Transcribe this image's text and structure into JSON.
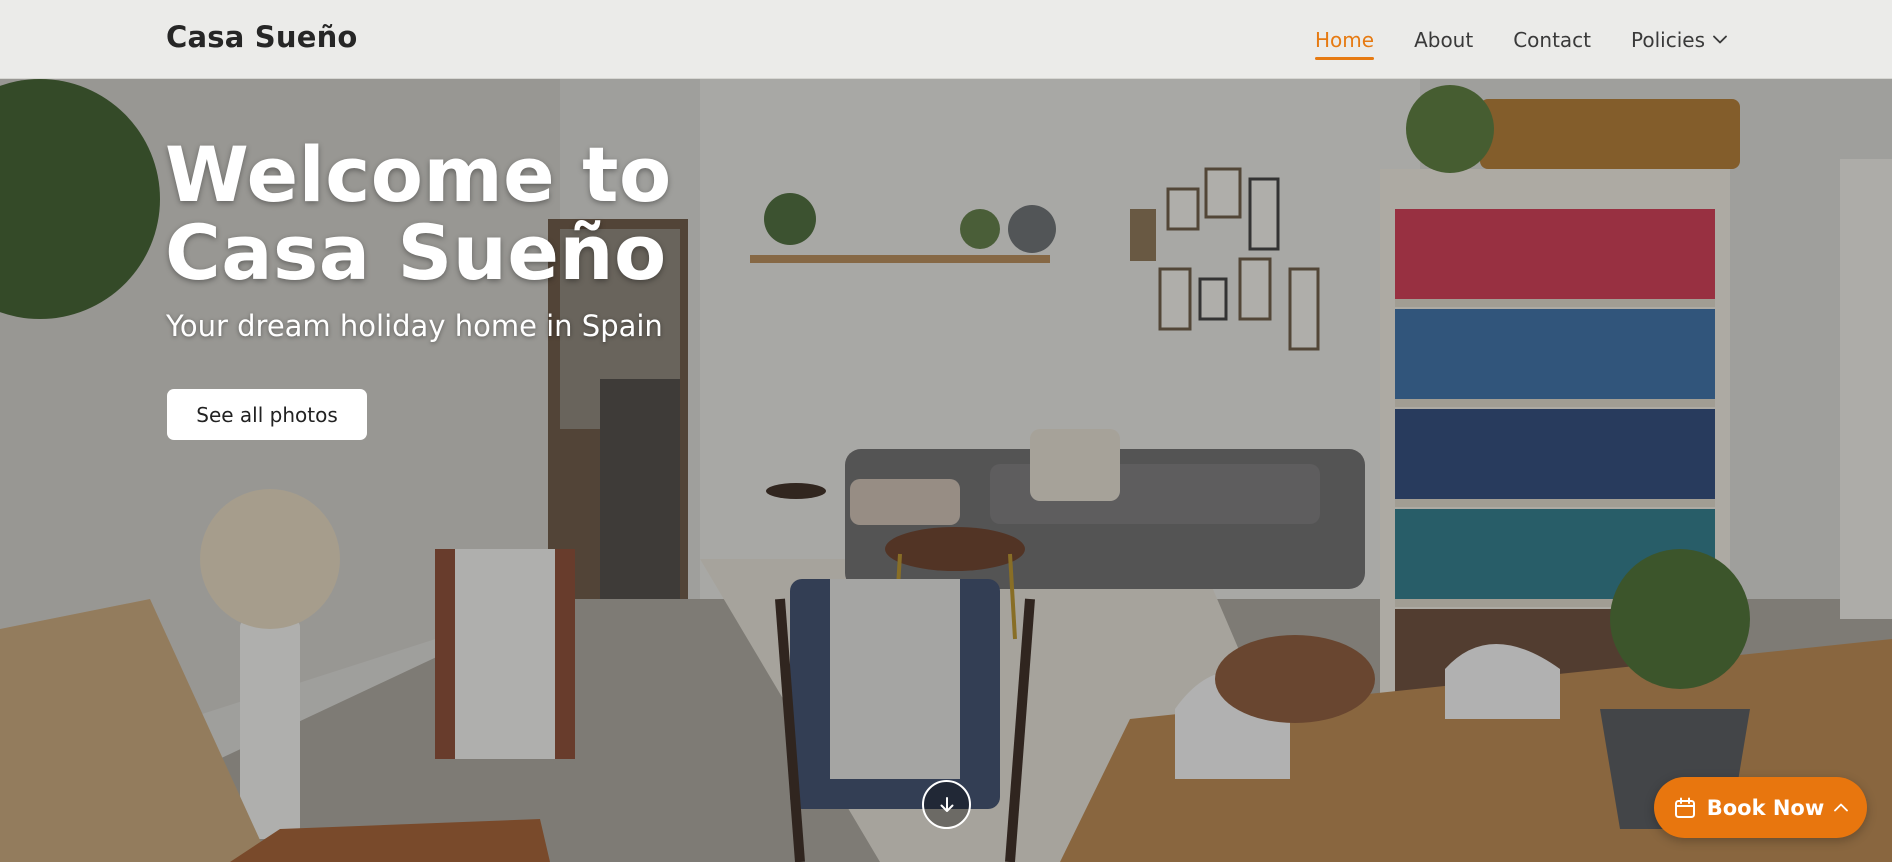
{
  "header": {
    "brand": "Casa Sueño",
    "nav": [
      {
        "label": "Home",
        "active": true
      },
      {
        "label": "About",
        "active": false
      },
      {
        "label": "Contact",
        "active": false
      },
      {
        "label": "Policies",
        "active": false,
        "has_dropdown": true
      }
    ]
  },
  "hero": {
    "title_line1": "Welcome to",
    "title_line2": "Casa Sueño",
    "subtitle": "Your dream holiday home in Spain",
    "photos_button": "See all photos",
    "scroll_icon": "arrow-down-icon"
  },
  "booking": {
    "label": "Book Now",
    "icon": "calendar-icon",
    "toggle_icon": "chevron-up-icon"
  },
  "colors": {
    "accent": "#e67a12",
    "book_button": "#e8760e",
    "header_bg": "#ebebe9"
  }
}
